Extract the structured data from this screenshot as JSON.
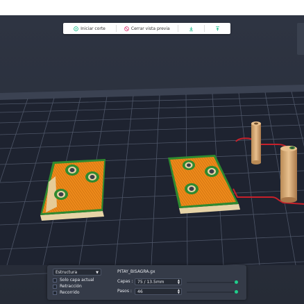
{
  "toolbar": {
    "start_slice_label": "Iniciar corte",
    "close_preview_label": "Cerrar vista previa",
    "download_icon": "download-icon",
    "upload_icon": "upload-icon",
    "accent_color": "#1fbf8f",
    "close_color": "#e0407a"
  },
  "panel": {
    "view_mode": "Estructura",
    "options": [
      {
        "label": "Solo capa actual",
        "checked": false
      },
      {
        "label": "Retracción",
        "checked": false
      },
      {
        "label": "Recorrido",
        "checked": false
      }
    ],
    "filename": "PITAY_BISAGRA.gx",
    "layers_label": "Capas :",
    "layers_value": "75 / 13.5mm",
    "steps_label": "Pasos :",
    "steps_value": "46",
    "layers_slider_fraction": 1.0,
    "steps_slider_fraction": 1.0
  },
  "colors": {
    "bed": "#1d2230",
    "grid_line": "#4e5668",
    "print_fill": "#ee8a1a",
    "print_outline": "#2f8a2f",
    "print_base": "#e6d3a6",
    "travel": "#c8202a",
    "dowel": "#d9a873"
  }
}
